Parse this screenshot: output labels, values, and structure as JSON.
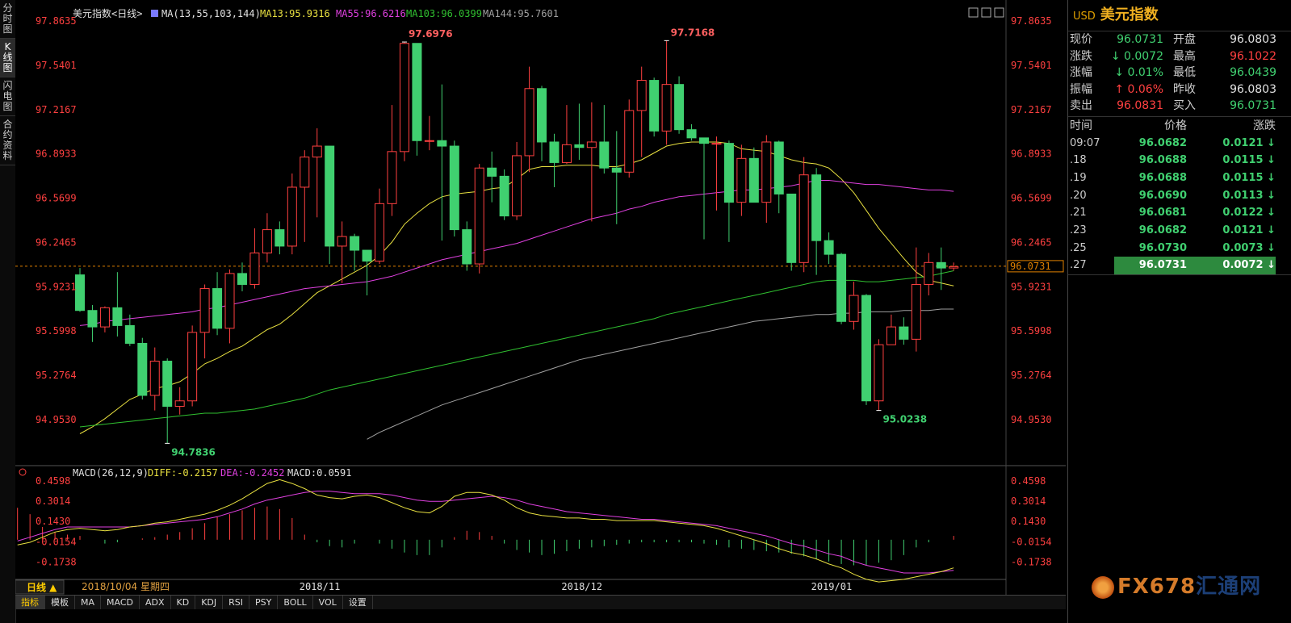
{
  "side_tabs": [
    "分时图",
    "K线图",
    "闪电图",
    "合约资料"
  ],
  "header": {
    "name": "美元指数<日线>",
    "ma_spec": "MA(13,55,103,144)",
    "ma13": "MA13:95.9316",
    "ma55": "MA55:96.6216",
    "ma103": "MA103:96.0399",
    "ma144": "MA144:95.7601"
  },
  "macd_header": {
    "spec": "MACD(26,12,9)",
    "diff": "DIFF:-0.2157",
    "dea": "DEA:-0.2452",
    "macd": "MACD:0.0591"
  },
  "period_label": "日线 ▲",
  "cursor_date": "2018/10/04  星期四",
  "bottom_tabs": [
    "指标",
    "模板",
    "MA",
    "MACD",
    "ADX",
    "KD",
    "KDJ",
    "RSI",
    "PSY",
    "BOLL",
    "VOL",
    "设置"
  ],
  "last_price_tag": "96.0731",
  "peak_labels": {
    "high1": "97.6976",
    "high2": "97.7168",
    "low1": "94.7836",
    "low2": "95.0238"
  },
  "quote": {
    "currency": "USD",
    "name": "美元指数",
    "rows": [
      {
        "l1": "现价",
        "v1": "96.0731",
        "c1": "dn",
        "l2": "开盘",
        "v2": "96.0803",
        "c2": "wt"
      },
      {
        "l1": "涨跌",
        "v1": "↓ 0.0072",
        "c1": "dn",
        "l2": "最高",
        "v2": "96.1022",
        "c2": "up"
      },
      {
        "l1": "涨幅",
        "v1": "↓ 0.01%",
        "c1": "dn",
        "l2": "最低",
        "v2": "96.0439",
        "c2": "dn"
      },
      {
        "l1": "振幅",
        "v1": "↑ 0.06%",
        "c1": "up",
        "l2": "昨收",
        "v2": "96.0803",
        "c2": "wt"
      },
      {
        "l1": "卖出",
        "v1": "96.0831",
        "c1": "up",
        "l2": "买入",
        "v2": "96.0731",
        "c2": "dn"
      }
    ],
    "tick_headers": [
      "时间",
      "价格",
      "涨跌"
    ],
    "ticks": [
      {
        "t": "09:07",
        "p": "96.0682",
        "c": "0.0121 ↓"
      },
      {
        "t": ".18",
        "p": "96.0688",
        "c": "0.0115 ↓"
      },
      {
        "t": ".19",
        "p": "96.0688",
        "c": "0.0115 ↓"
      },
      {
        "t": ".20",
        "p": "96.0690",
        "c": "0.0113 ↓"
      },
      {
        "t": ".21",
        "p": "96.0681",
        "c": "0.0122 ↓"
      },
      {
        "t": ".23",
        "p": "96.0682",
        "c": "0.0121 ↓"
      },
      {
        "t": ".25",
        "p": "96.0730",
        "c": "0.0073 ↓"
      },
      {
        "t": ".27",
        "p": "96.0731",
        "c": "0.0072 ↓"
      }
    ]
  },
  "logo": {
    "fx": "FX678",
    "cn": "汇通网"
  },
  "colors": {
    "up": "#ff4040",
    "down": "#40d070",
    "ma13": "#e8e040",
    "ma55": "#e040e0",
    "ma103": "#30c030",
    "ma144": "#a0a0a0",
    "diff": "#e8e040",
    "dea": "#e040e0"
  },
  "chart_data": {
    "type": "candlestick",
    "price_axis": {
      "ticks": [
        97.8635,
        97.5401,
        97.2167,
        96.8933,
        96.5699,
        96.2465,
        95.9231,
        95.5998,
        95.2764,
        94.953
      ],
      "ylim": [
        94.73,
        97.95
      ]
    },
    "x_labels": [
      {
        "i": 19,
        "label": "2018/11"
      },
      {
        "i": 40,
        "label": "2018/12"
      },
      {
        "i": 60,
        "label": "2019/01"
      }
    ],
    "candles": [
      [
        96.01,
        95.75,
        96.06,
        95.74
      ],
      [
        95.75,
        95.63,
        95.79,
        95.52
      ],
      [
        95.63,
        95.77,
        95.78,
        95.59
      ],
      [
        95.77,
        95.64,
        96.03,
        95.56
      ],
      [
        95.64,
        95.51,
        95.72,
        95.49
      ],
      [
        95.51,
        95.13,
        95.55,
        95.1
      ],
      [
        95.13,
        95.38,
        95.48,
        95.02
      ],
      [
        95.38,
        95.05,
        95.4,
        94.78
      ],
      [
        95.05,
        95.09,
        95.19,
        94.99
      ],
      [
        95.09,
        95.59,
        95.64,
        95.05
      ],
      [
        95.59,
        95.91,
        95.94,
        95.4
      ],
      [
        95.91,
        95.62,
        96.03,
        95.57
      ],
      [
        95.62,
        96.02,
        96.05,
        95.51
      ],
      [
        96.02,
        95.94,
        96.1,
        95.89
      ],
      [
        95.94,
        96.17,
        96.35,
        95.91
      ],
      [
        96.17,
        96.34,
        96.46,
        96.1
      ],
      [
        96.34,
        96.22,
        96.4,
        96.16
      ],
      [
        96.22,
        96.65,
        96.75,
        96.16
      ],
      [
        96.65,
        96.87,
        96.92,
        96.25
      ],
      [
        96.87,
        96.95,
        97.08,
        96.43
      ],
      [
        96.95,
        96.22,
        96.95,
        96.09
      ],
      [
        96.22,
        96.29,
        96.4,
        95.95
      ],
      [
        96.29,
        96.19,
        96.31,
        96.04
      ],
      [
        96.19,
        96.11,
        96.14,
        95.86
      ],
      [
        96.11,
        96.53,
        96.64,
        96.09
      ],
      [
        96.53,
        96.91,
        97.25,
        96.44
      ],
      [
        96.91,
        97.7,
        97.71,
        96.84
      ],
      [
        97.7,
        96.99,
        97.7,
        96.88
      ],
      [
        96.99,
        96.99,
        97.17,
        96.92
      ],
      [
        96.99,
        96.95,
        97.4,
        96.26
      ],
      [
        96.95,
        96.34,
        96.99,
        96.29
      ],
      [
        96.34,
        96.09,
        96.4,
        96.04
      ],
      [
        96.09,
        96.79,
        96.82,
        96.02
      ],
      [
        96.79,
        96.73,
        96.91,
        96.54
      ],
      [
        96.73,
        96.44,
        96.78,
        96.41
      ],
      [
        96.44,
        96.88,
        96.98,
        96.41
      ],
      [
        96.88,
        97.37,
        97.53,
        96.76
      ],
      [
        97.37,
        96.98,
        97.39,
        96.84
      ],
      [
        96.98,
        96.83,
        97.04,
        96.65
      ],
      [
        96.83,
        96.96,
        97.25,
        96.82
      ],
      [
        96.96,
        96.94,
        97.26,
        96.85
      ],
      [
        96.94,
        96.98,
        97.27,
        96.4
      ],
      [
        96.98,
        96.79,
        97.25,
        96.75
      ],
      [
        96.79,
        96.76,
        97.06,
        96.38
      ],
      [
        96.76,
        97.21,
        97.29,
        96.72
      ],
      [
        97.21,
        97.43,
        97.53,
        96.87
      ],
      [
        97.43,
        97.06,
        97.45,
        97.02
      ],
      [
        97.06,
        97.4,
        97.72,
        96.96
      ],
      [
        97.4,
        97.07,
        97.46,
        97.04
      ],
      [
        97.07,
        97.01,
        97.11,
        96.99
      ],
      [
        97.01,
        96.97,
        97.01,
        96.27
      ],
      [
        96.97,
        96.97,
        97.02,
        96.48
      ],
      [
        96.97,
        96.54,
        96.99,
        96.25
      ],
      [
        96.54,
        96.86,
        96.96,
        96.44
      ],
      [
        96.86,
        96.54,
        96.94,
        96.55
      ],
      [
        96.54,
        96.98,
        97.03,
        96.39
      ],
      [
        96.98,
        96.6,
        96.99,
        96.46
      ],
      [
        96.6,
        96.1,
        96.6,
        96.04
      ],
      [
        96.1,
        96.74,
        96.87,
        96.03
      ],
      [
        96.74,
        96.26,
        96.79,
        96.01
      ],
      [
        96.26,
        96.16,
        96.32,
        96.09
      ],
      [
        96.16,
        95.67,
        96.17,
        95.65
      ],
      [
        95.67,
        95.86,
        95.96,
        95.61
      ],
      [
        95.86,
        95.09,
        95.87,
        95.06
      ],
      [
        95.09,
        95.5,
        95.54,
        95.02
      ],
      [
        95.5,
        95.63,
        95.72,
        95.5
      ],
      [
        95.63,
        95.54,
        95.7,
        95.5
      ],
      [
        95.54,
        95.94,
        96.21,
        95.45
      ],
      [
        95.94,
        96.1,
        96.17,
        95.86
      ],
      [
        96.1,
        96.06,
        96.21,
        95.9
      ],
      [
        96.06,
        96.07,
        96.1,
        96.04
      ]
    ],
    "ma13": [
      94.85,
      94.9,
      94.96,
      95.03,
      95.1,
      95.14,
      95.18,
      95.2,
      95.23,
      95.29,
      95.36,
      95.4,
      95.45,
      95.49,
      95.55,
      95.61,
      95.65,
      95.72,
      95.8,
      95.88,
      95.93,
      95.98,
      96.03,
      96.08,
      96.15,
      96.25,
      96.38,
      96.46,
      96.53,
      96.58,
      96.6,
      96.61,
      96.62,
      96.64,
      96.65,
      96.71,
      96.78,
      96.8,
      96.8,
      96.81,
      96.81,
      96.81,
      96.8,
      96.8,
      96.82,
      96.85,
      96.9,
      96.95,
      96.97,
      96.98,
      96.98,
      96.98,
      96.97,
      96.93,
      96.92,
      96.91,
      96.88,
      96.85,
      96.83,
      96.82,
      96.79,
      96.71,
      96.61,
      96.48,
      96.35,
      96.24,
      96.13,
      96.03,
      95.97,
      95.95,
      95.93
    ],
    "ma55": [
      95.64,
      95.65,
      95.67,
      95.68,
      95.69,
      95.7,
      95.71,
      95.72,
      95.73,
      95.74,
      95.76,
      95.77,
      95.79,
      95.81,
      95.83,
      95.85,
      95.87,
      95.89,
      95.91,
      95.92,
      95.93,
      95.94,
      95.95,
      95.96,
      95.98,
      96.0,
      96.03,
      96.06,
      96.09,
      96.12,
      96.14,
      96.16,
      96.18,
      96.2,
      96.22,
      96.24,
      96.27,
      96.3,
      96.33,
      96.36,
      96.39,
      96.42,
      96.44,
      96.46,
      96.49,
      96.51,
      96.54,
      96.56,
      96.58,
      96.59,
      96.6,
      96.61,
      96.62,
      96.63,
      96.63,
      96.64,
      96.65,
      96.66,
      96.68,
      96.7,
      96.7,
      96.69,
      96.68,
      96.67,
      96.67,
      96.66,
      96.65,
      96.64,
      96.63,
      96.63,
      96.62
    ],
    "ma103": [
      94.9,
      94.91,
      94.92,
      94.93,
      94.94,
      94.95,
      94.96,
      94.97,
      94.98,
      94.99,
      95.0,
      95.0,
      95.01,
      95.02,
      95.03,
      95.05,
      95.07,
      95.09,
      95.11,
      95.14,
      95.17,
      95.19,
      95.21,
      95.23,
      95.25,
      95.27,
      95.29,
      95.31,
      95.33,
      95.35,
      95.37,
      95.39,
      95.41,
      95.43,
      95.45,
      95.47,
      95.49,
      95.51,
      95.53,
      95.55,
      95.57,
      95.59,
      95.61,
      95.63,
      95.65,
      95.67,
      95.69,
      95.72,
      95.74,
      95.76,
      95.78,
      95.8,
      95.82,
      95.84,
      95.86,
      95.88,
      95.9,
      95.92,
      95.94,
      95.96,
      95.97,
      95.97,
      95.97,
      95.96,
      95.96,
      95.97,
      95.98,
      95.99,
      96.0,
      96.02,
      96.04
    ],
    "ma144": [
      null,
      null,
      null,
      null,
      null,
      null,
      null,
      null,
      null,
      null,
      null,
      null,
      null,
      null,
      null,
      null,
      null,
      null,
      null,
      null,
      null,
      null,
      null,
      94.81,
      94.86,
      94.9,
      94.94,
      94.98,
      95.02,
      95.06,
      95.09,
      95.12,
      95.15,
      95.18,
      95.21,
      95.24,
      95.27,
      95.3,
      95.33,
      95.36,
      95.39,
      95.41,
      95.43,
      95.45,
      95.47,
      95.49,
      95.51,
      95.53,
      95.55,
      95.57,
      95.59,
      95.61,
      95.63,
      95.65,
      95.67,
      95.68,
      95.69,
      95.7,
      95.71,
      95.72,
      95.72,
      95.73,
      95.73,
      95.74,
      95.74,
      95.74,
      95.75,
      95.75,
      95.75,
      95.76,
      95.76
    ],
    "macd_axis": {
      "ticks": [
        0.4598,
        0.3014,
        0.143,
        -0.0154,
        -0.1738
      ],
      "ylim": [
        -0.3,
        0.52
      ]
    },
    "diff": [
      -0.06,
      -0.04,
      -0.02,
      0.02,
      0.06,
      0.08,
      0.09,
      0.08,
      0.07,
      0.08,
      0.1,
      0.11,
      0.13,
      0.14,
      0.16,
      0.18,
      0.2,
      0.23,
      0.27,
      0.32,
      0.38,
      0.44,
      0.47,
      0.44,
      0.4,
      0.35,
      0.33,
      0.32,
      0.34,
      0.35,
      0.33,
      0.29,
      0.25,
      0.22,
      0.21,
      0.26,
      0.34,
      0.37,
      0.37,
      0.35,
      0.31,
      0.25,
      0.21,
      0.19,
      0.18,
      0.17,
      0.17,
      0.16,
      0.16,
      0.15,
      0.15,
      0.15,
      0.15,
      0.14,
      0.13,
      0.12,
      0.11,
      0.09,
      0.06,
      0.03,
      0.0,
      -0.03,
      -0.07,
      -0.1,
      -0.12,
      -0.15,
      -0.19,
      -0.22,
      -0.27,
      -0.31,
      -0.33,
      -0.32,
      -0.31,
      -0.29,
      -0.27,
      -0.25,
      -0.22
    ],
    "dea": [
      -0.03,
      -0.01,
      0.02,
      0.05,
      0.08,
      0.1,
      0.1,
      0.1,
      0.1,
      0.1,
      0.1,
      0.11,
      0.12,
      0.13,
      0.14,
      0.15,
      0.16,
      0.18,
      0.21,
      0.24,
      0.28,
      0.31,
      0.33,
      0.35,
      0.37,
      0.38,
      0.38,
      0.37,
      0.36,
      0.36,
      0.36,
      0.35,
      0.33,
      0.31,
      0.3,
      0.3,
      0.31,
      0.32,
      0.33,
      0.34,
      0.33,
      0.31,
      0.28,
      0.26,
      0.24,
      0.22,
      0.21,
      0.2,
      0.19,
      0.18,
      0.17,
      0.16,
      0.16,
      0.15,
      0.14,
      0.13,
      0.12,
      0.11,
      0.09,
      0.07,
      0.05,
      0.03,
      0.0,
      -0.03,
      -0.05,
      -0.08,
      -0.11,
      -0.13,
      -0.17,
      -0.2,
      -0.22,
      -0.24,
      -0.26,
      -0.26,
      -0.26,
      -0.25,
      -0.24
    ],
    "macd_bars": [
      0.3,
      0.25,
      0.2,
      0.1,
      0.06,
      0.04,
      0.03,
      0.0,
      -0.03,
      -0.02,
      0.0,
      0.01,
      0.02,
      0.04,
      0.06,
      0.09,
      0.13,
      0.18,
      0.2,
      0.23,
      0.25,
      0.26,
      0.24,
      0.17,
      0.04,
      -0.02,
      -0.05,
      -0.06,
      -0.03,
      0.0,
      -0.03,
      -0.07,
      -0.1,
      -0.12,
      -0.12,
      -0.06,
      0.02,
      0.07,
      0.06,
      0.03,
      -0.03,
      -0.08,
      -0.1,
      -0.12,
      -0.11,
      -0.09,
      -0.07,
      -0.06,
      -0.05,
      -0.04,
      -0.03,
      -0.02,
      -0.02,
      -0.02,
      -0.02,
      -0.02,
      -0.03,
      -0.04,
      -0.06,
      -0.07,
      -0.08,
      -0.09,
      -0.1,
      -0.11,
      -0.13,
      -0.15,
      -0.17,
      -0.19,
      -0.2,
      -0.2,
      -0.18,
      -0.16,
      -0.12,
      -0.06,
      -0.02,
      0.0,
      0.03
    ]
  }
}
